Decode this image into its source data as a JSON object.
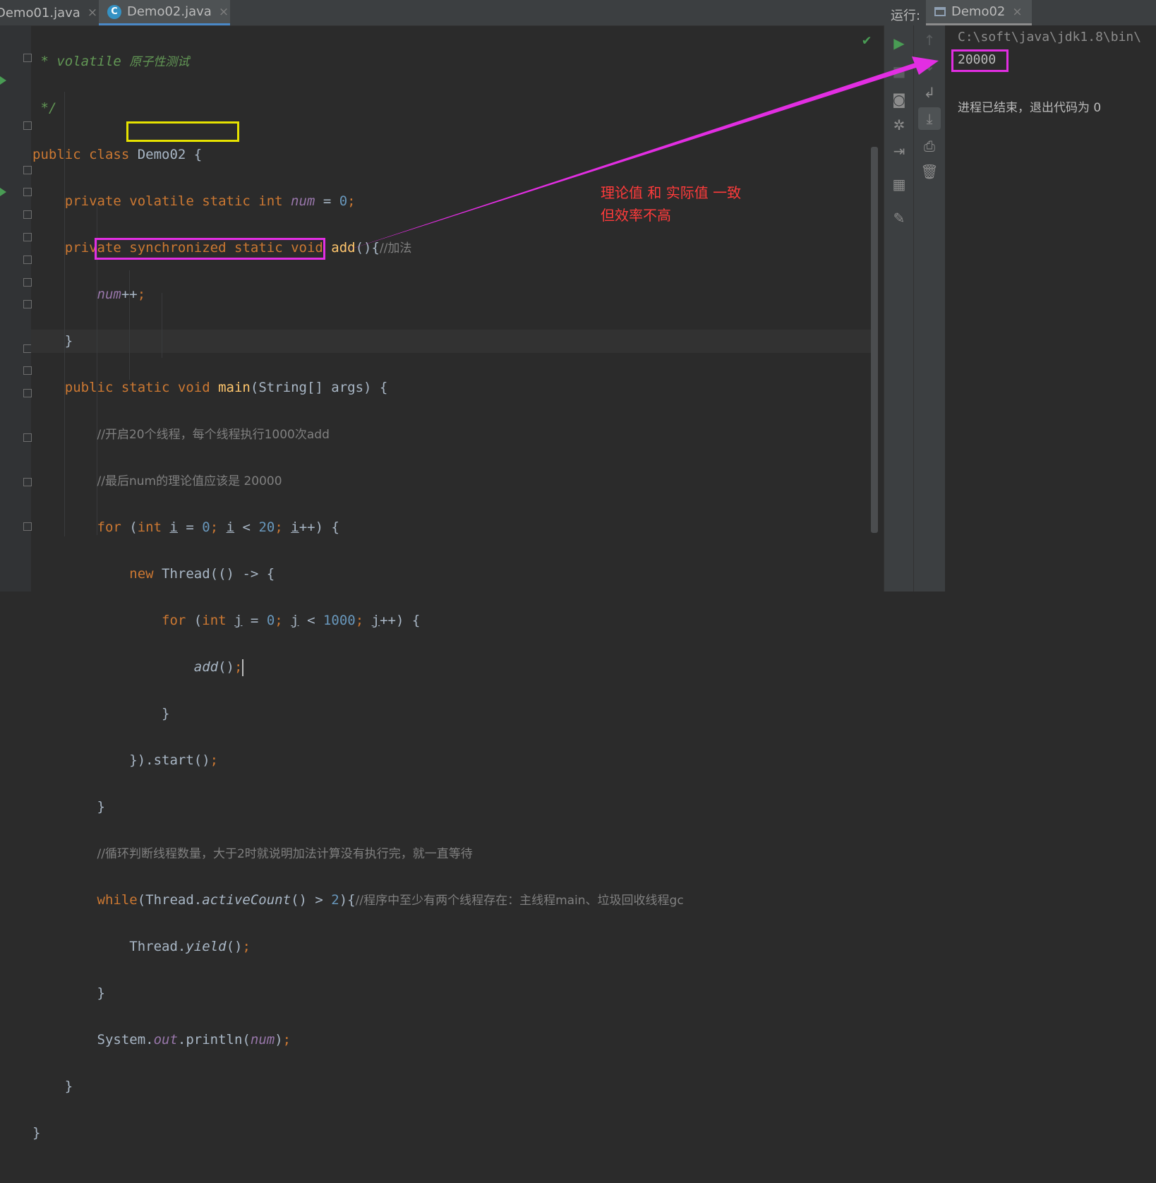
{
  "tabs": [
    {
      "label": "Demo01.java",
      "close": "×"
    },
    {
      "label": "Demo02.java",
      "close": "×",
      "icon": "C"
    }
  ],
  "code": {
    "l1_kw": " * volatile ",
    "l1_txt": "原子性测试",
    "l2": " */",
    "l3_kw": "public class ",
    "l3_name": "Demo02 {",
    "l4_kw": "    private volatile static int ",
    "l4_field": "num",
    "l4_eq": " = ",
    "l4_val": "0",
    "l4_end": ";",
    "l5_kw1": "    private ",
    "l5_sync": "synchronized",
    "l5_kw2": " static void ",
    "l5_fn": "add",
    "l5_rest": "(){",
    "l5_cm": "//加法",
    "l6_field": "num",
    "l6_rest": "++",
    "l6_semi": ";",
    "l7": "    }",
    "l8_kw": "    public static void ",
    "l8_fn": "main",
    "l8_rest": "(String[] args) {",
    "l9_cm": "//开启20个线程，每个线程执行1000次add",
    "l10_cm": "//最后num的理论值应该是 20000",
    "l11_for": "for",
    "l11_p1": " (",
    "l11_int": "int",
    "l11_i1": "i",
    "l11_eq": " = ",
    "l11_v0": "0",
    "l11_semi": ";",
    "l11_i2": "i",
    "l11_lt": " < ",
    "l11_v20": "20",
    "l11_i3": "i",
    "l11_end": "++) {",
    "l12_new": "new",
    "l12_rest": " Thread(() -> {",
    "l13_for": "for",
    "l13_p1": " (",
    "l13_int": "int",
    "l13_j1": "j",
    "l13_eq": " = ",
    "l13_v0": "0",
    "l13_semi": ";",
    "l13_j2": "j",
    "l13_lt": " < ",
    "l13_v": "1000",
    "l13_j3": "j",
    "l13_end": "++) {",
    "l14_fn": "add",
    "l14_rest": "()",
    "l14_semi": ";",
    "l15": "}",
    "l16_a": "}).start()",
    "l16_semi": ";",
    "l17": "}",
    "l18_cm": "//循环判断线程数量，大于2时就说明加法计算没有执行完，就一直等待",
    "l19_kw": "while",
    "l19_a": "(Thread.",
    "l19_it": "activeCount",
    "l19_b": "() > ",
    "l19_num": "2",
    "l19_c": "){",
    "l19_cm": "//程序中至少有两个线程存在：主线程main、垃圾回收线程gc",
    "l20_a": "Thread.",
    "l20_it": "yield",
    "l20_b": "()",
    "l20_semi": ";",
    "l21": "}",
    "l22_a": "System.",
    "l22_out": "out",
    "l22_b": ".println(",
    "l22_field": "num",
    "l22_c": ")",
    "l22_semi": ";",
    "l23": "    }",
    "l24": "}"
  },
  "run": {
    "label": "运行:",
    "tab": "Demo02",
    "close": "×"
  },
  "console": {
    "path": "C:\\soft\\java\\jdk1.8\\bin\\",
    "output": "20000",
    "exit": "进程已结束，退出代码为 0"
  },
  "annotation": {
    "line1": "理论值 和 实际值 一致",
    "line2": "但效率不高",
    "color": "#ff3b3b",
    "arrow_color": "#e22ee2"
  },
  "colors": {
    "keyword": "#cc7832",
    "function": "#ffc66d",
    "number": "#6897bb",
    "field": "#9876aa",
    "comment": "#808080",
    "doc": "#629755",
    "highlight_sync": "#e6e200",
    "highlight_box": "#e22ee2"
  }
}
